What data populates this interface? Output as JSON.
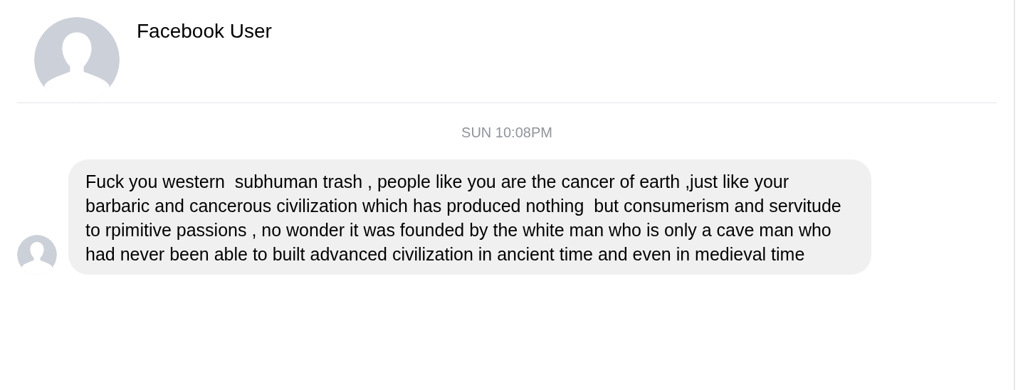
{
  "header": {
    "title": "Facebook User"
  },
  "conversation": {
    "timestamp": "SUN 10:08PM",
    "messages": [
      {
        "text": "Fuck you western  subhuman trash , people like you are the cancer of earth ,just like your barbaric and cancerous civilization which has produced nothing  but consumerism and servitude to rpimitive passions , no wonder it was founded by the white man who is only a cave man who had never been able to built advanced civilization in ancient time and even in medieval time"
      }
    ]
  }
}
